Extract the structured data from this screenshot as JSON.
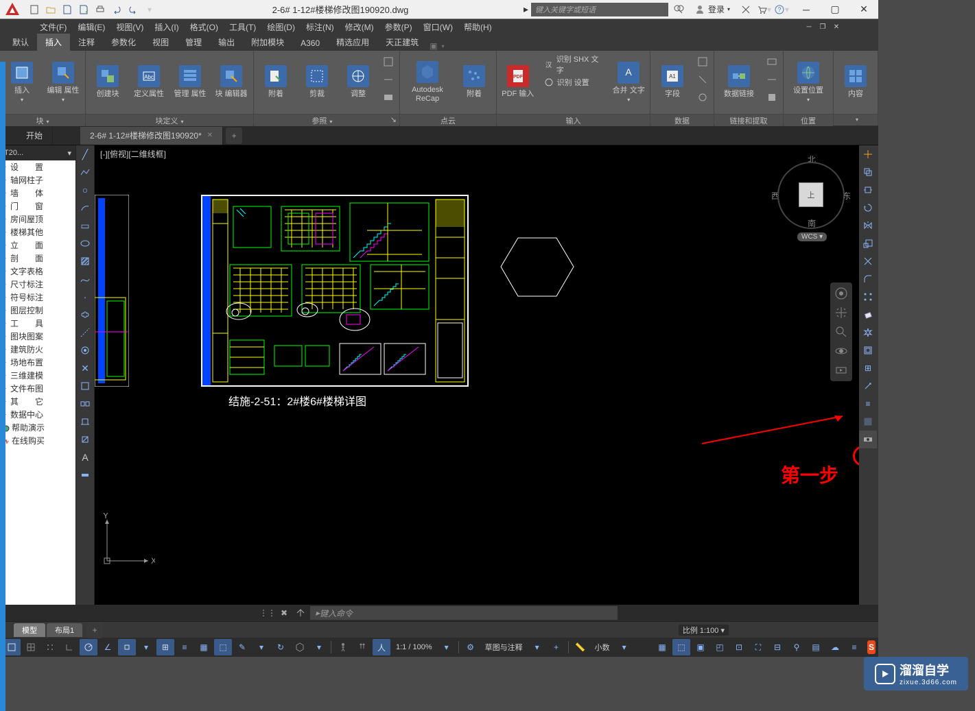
{
  "title": "2-6# 1-12#楼梯修改图190920.dwg",
  "search_placeholder": "键入关键字或短语",
  "login_label": "登录",
  "menus": [
    "文件(F)",
    "编辑(E)",
    "视图(V)",
    "插入(I)",
    "格式(O)",
    "工具(T)",
    "绘图(D)",
    "标注(N)",
    "修改(M)",
    "参数(P)",
    "窗口(W)",
    "帮助(H)"
  ],
  "ribbon_tabs": [
    "默认",
    "插入",
    "注释",
    "参数化",
    "视图",
    "管理",
    "输出",
    "附加模块",
    "A360",
    "精选应用",
    "天正建筑"
  ],
  "active_tab_index": 1,
  "ribbon": {
    "block": {
      "title": "块",
      "btns": {
        "insert": "插入",
        "edit_attr": "编辑\n属性",
        "create": "创建块",
        "def_attr": "定义属性",
        "mgr_attr": "管理\n属性",
        "block_editor": "块\n编辑器"
      }
    },
    "blockdef": {
      "title": "块定义"
    },
    "ref": {
      "title": "参照",
      "btns": {
        "attach": "附着",
        "clip": "剪裁",
        "adjust": "调整"
      }
    },
    "pointcloud": {
      "title": "点云",
      "btns": {
        "recap": "Autodesk\nReCap",
        "attach": "附着"
      }
    },
    "import": {
      "title": "输入",
      "btns": {
        "pdf": "PDF\n输入",
        "shx": "识别 SHX 文字",
        "settings": "识别 设置",
        "merge": "合并\n文字"
      }
    },
    "data": {
      "title": "数据",
      "btns": {
        "field": "字段"
      }
    },
    "link": {
      "title": "链接和提取",
      "btns": {
        "datalink": "数据链接"
      }
    },
    "location": {
      "title": "位置",
      "btns": {
        "setloc": "设置位置"
      }
    },
    "content": {
      "title": "内容",
      "btns": {
        "content": "内容"
      }
    }
  },
  "file_tabs": {
    "start": "开始",
    "active": "2-6# 1-12#楼梯修改图190920*"
  },
  "palette": {
    "header": "T20...",
    "items": [
      "设　　置",
      "轴网柱子",
      "墙　　体",
      "门　　窗",
      "房间屋顶",
      "楼梯其他",
      "立　　面",
      "剖　　面",
      "文字表格",
      "尺寸标注",
      "符号标注",
      "图层控制",
      "工　　具",
      "图块图案",
      "建筑防火",
      "场地布置",
      "三维建模",
      "文件布图",
      "其　　它",
      "数据中心",
      "帮助演示",
      "在线购买"
    ]
  },
  "viewport_label": "[-][俯视][二维线框]",
  "drawing_caption": "结施-2-51：2#楼6#楼梯详图",
  "viewcube": {
    "n": "北",
    "s": "南",
    "e": "东",
    "w": "西",
    "top": "上",
    "wcs": "WCS"
  },
  "annotation": "第一步",
  "cmdline_placeholder": "键入命令",
  "model_tabs": {
    "model": "模型",
    "layout1": "布局1"
  },
  "scale": "比例 1:100",
  "status": {
    "zoom": "1:1 / 100%",
    "annoscale": "草图与注释",
    "decimals": "小数"
  },
  "watermark": {
    "main": "溜溜自学",
    "sub": "zixue.3d66.com"
  },
  "ucs_labels": {
    "x": "X",
    "y": "Y"
  }
}
